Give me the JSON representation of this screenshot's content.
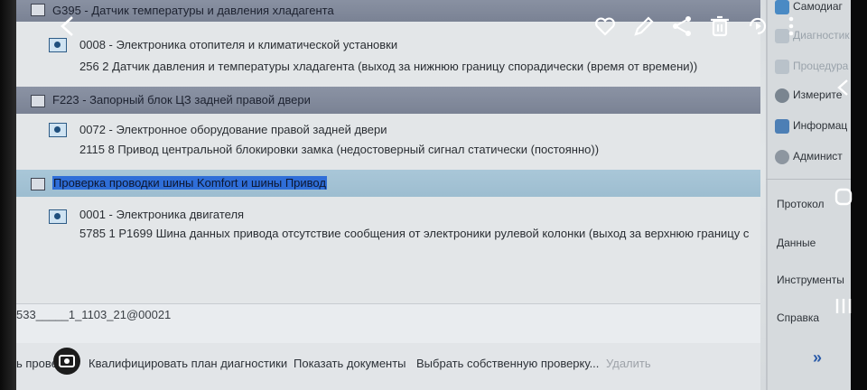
{
  "rows": [
    {
      "type": "header",
      "text": "G395 - Датчик температуры и давления хладагента"
    },
    {
      "type": "entry",
      "title": "0008 - Электроника отопителя и климатической установки",
      "detail": "256   2   Датчик давления и температуры хладагента  (выход за нижнюю границу   спорадически (время от времени))"
    },
    {
      "type": "header",
      "text": "F223 - Запорный блок ЦЗ задней правой двери"
    },
    {
      "type": "entry",
      "title": "0072 - Электронное оборудование правой задней двери",
      "detail": "2115   8   Привод центральной блокировки замка  (недостоверный сигнал   статически (постоянно))"
    },
    {
      "type": "header",
      "text": "Проверка проводки шины Komfort и шины Привод",
      "selected": true
    },
    {
      "type": "entry",
      "title": "0001 - Электроника двигателя",
      "detail": "5785   1   P1699   Шина данных привода отсутствие сообщения от электроники рулевой колонки  (выход за верхнюю границу   с"
    }
  ],
  "status_text": "533_____1_1103_21@00021",
  "bottom_buttons": [
    {
      "label": "ь провер"
    },
    {
      "label": "Квалифицировать план диагностики"
    },
    {
      "label": "Показать документы"
    },
    {
      "label": "Выбрать собственную проверку..."
    },
    {
      "label": "Удалить",
      "disabled": true
    }
  ],
  "sidebar_top": [
    {
      "label": "Самодиаг"
    },
    {
      "label": "Диагностик",
      "dim": true
    },
    {
      "label": "Процедура",
      "dim": true
    },
    {
      "label": "Измерите"
    },
    {
      "label": "Информац"
    },
    {
      "label": "Админист"
    }
  ],
  "sidebar_bottom": [
    "Протокол",
    "Данные",
    "Инструменты",
    "Справка"
  ],
  "overlay_icons": [
    "back-icon",
    "heart-icon",
    "edit-icon",
    "share-icon",
    "delete-icon",
    "rotate-icon",
    "more-icon",
    "lock-screenshot-icon"
  ],
  "colors": {
    "header_bg": "#7f8799",
    "selected_header_bg": "#a3c2d4",
    "highlight": "#2f6ed8"
  }
}
